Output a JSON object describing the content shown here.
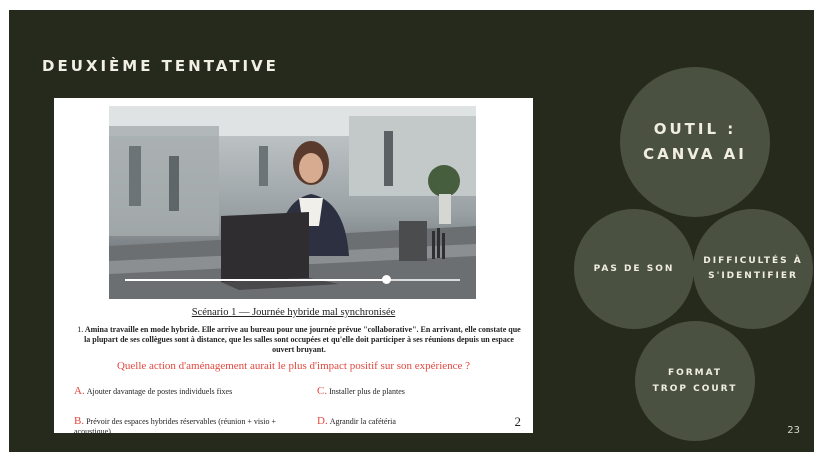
{
  "slide": {
    "title": "DEUXIÈME TENTATIVE",
    "page_number": "23",
    "background": "#252a1c",
    "circle_color": "#4b5140"
  },
  "circles": {
    "outil_line1": "OUTIL :",
    "outil_line2": "CANVA AI",
    "son": "PAS DE SON",
    "diff_line1": "DIFFICULTÉS À",
    "diff_line2": "S'IDENTIFIER",
    "format_line1": "FORMAT",
    "format_line2": "TROP COURT"
  },
  "document": {
    "scenario_title": "Scénario 1 — Journée hybride mal synchronisée",
    "scenario_number": "1.",
    "scenario_text": "Amina travaille en mode hybride. Elle arrive au bureau pour une journée prévue \"collaborative\". En arrivant, elle constate que la plupart de ses collègues sont à distance, que les salles sont occupées et qu'elle doit participer à ses réunions depuis un espace ouvert bruyant.",
    "question": "Quelle action d'aménagement aurait le plus d'impact positif sur son expérience ?",
    "options": [
      {
        "letter": "A.",
        "text": "Ajouter davantage de postes individuels fixes"
      },
      {
        "letter": "B.",
        "text": "Prévoir des espaces hybrides réservables (réunion + visio + acoustique)"
      },
      {
        "letter": "C.",
        "text": "Installer plus de plantes"
      },
      {
        "letter": "D.",
        "text": "Agrandir la cafétéria"
      }
    ],
    "page": "2",
    "video_progress": 0.78
  },
  "icons": [
    "video-progress-knob"
  ],
  "accent_color": "#e2473e"
}
